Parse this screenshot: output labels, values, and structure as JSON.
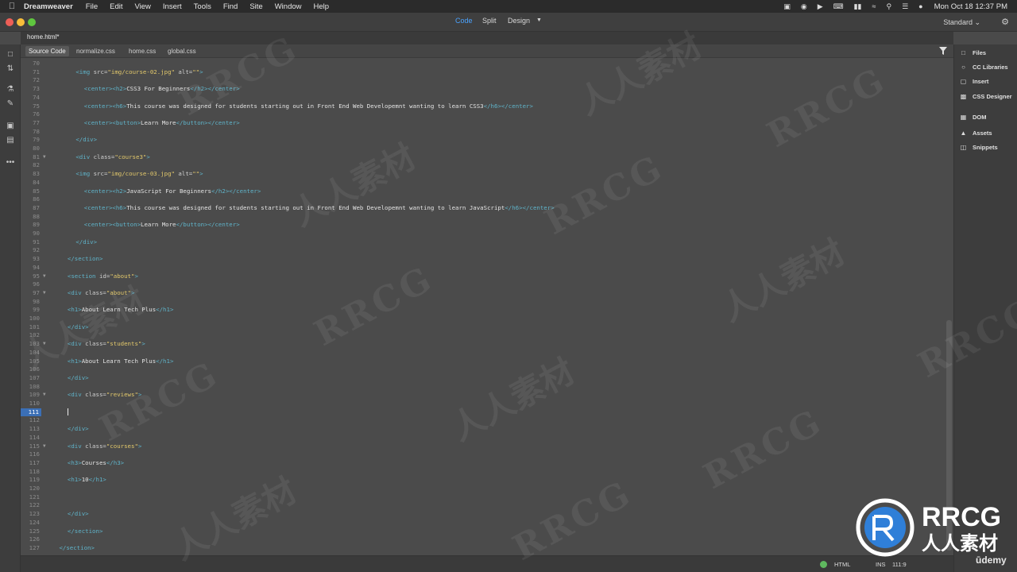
{
  "menubar": {
    "app_name": "Dreamweaver",
    "items": [
      "File",
      "Edit",
      "View",
      "Insert",
      "Tools",
      "Find",
      "Site",
      "Window",
      "Help"
    ],
    "clock": "Mon Oct 18  12:37 PM"
  },
  "toolbar": {
    "views": [
      "Code",
      "Split",
      "Design"
    ],
    "active_view": "Code",
    "workspace": "Standard"
  },
  "document": {
    "tab": "home.html*",
    "related_files": [
      "Source Code",
      "normalize.css",
      "home.css",
      "global.css"
    ],
    "active_related": "Source Code"
  },
  "right_panel": {
    "items": [
      {
        "label": "Files",
        "icon": "files-icon"
      },
      {
        "label": "CC Libraries",
        "icon": "cc-libraries-icon"
      },
      {
        "label": "Insert",
        "icon": "insert-icon"
      },
      {
        "label": "CSS Designer",
        "icon": "css-designer-icon"
      },
      {
        "label": "DOM",
        "icon": "dom-icon"
      },
      {
        "label": "Assets",
        "icon": "assets-icon"
      },
      {
        "label": "Snippets",
        "icon": "snippets-icon"
      }
    ]
  },
  "editor": {
    "current_line": 111,
    "lines": [
      {
        "n": 70,
        "indent": 0,
        "code": ""
      },
      {
        "n": 71,
        "indent": 3,
        "code": "<img src=\"img/course-02.jpg\" alt=\"\">"
      },
      {
        "n": 72,
        "indent": 0,
        "code": ""
      },
      {
        "n": 73,
        "indent": 4,
        "code": "<center><h2>CSS3 For Beginners</h2></center>"
      },
      {
        "n": 74,
        "indent": 0,
        "code": ""
      },
      {
        "n": 75,
        "indent": 4,
        "code": "<center><h6>This course was designed for students starting out in Front End Web Developemnt wanting to learn CSS3</h6></center>"
      },
      {
        "n": 76,
        "indent": 0,
        "code": ""
      },
      {
        "n": 77,
        "indent": 4,
        "code": "<center><button>Learn More</button></center>"
      },
      {
        "n": 78,
        "indent": 0,
        "code": ""
      },
      {
        "n": 79,
        "indent": 3,
        "code": "</div>"
      },
      {
        "n": 80,
        "indent": 0,
        "code": ""
      },
      {
        "n": 81,
        "indent": 3,
        "code": "<div class=\"course3\">",
        "fold": true
      },
      {
        "n": 82,
        "indent": 0,
        "code": ""
      },
      {
        "n": 83,
        "indent": 3,
        "code": "<img src=\"img/course-03.jpg\" alt=\"\">"
      },
      {
        "n": 84,
        "indent": 0,
        "code": ""
      },
      {
        "n": 85,
        "indent": 4,
        "code": "<center><h2>JavaScript For Beginners</h2></center>"
      },
      {
        "n": 86,
        "indent": 0,
        "code": ""
      },
      {
        "n": 87,
        "indent": 4,
        "code": "<center><h6>This course was designed for students starting out in Front End Web Developemnt wanting to learn JavaScript</h6></center>"
      },
      {
        "n": 88,
        "indent": 0,
        "code": ""
      },
      {
        "n": 89,
        "indent": 4,
        "code": "<center><button>Learn More</button></center>"
      },
      {
        "n": 90,
        "indent": 0,
        "code": ""
      },
      {
        "n": 91,
        "indent": 3,
        "code": "</div>"
      },
      {
        "n": 92,
        "indent": 0,
        "code": ""
      },
      {
        "n": 93,
        "indent": 2,
        "code": "</section>"
      },
      {
        "n": 94,
        "indent": 0,
        "code": ""
      },
      {
        "n": 95,
        "indent": 2,
        "code": "<section id=\"about\">",
        "fold": true
      },
      {
        "n": 96,
        "indent": 0,
        "code": ""
      },
      {
        "n": 97,
        "indent": 2,
        "code": "<div class=\"about\">",
        "fold": true
      },
      {
        "n": 98,
        "indent": 0,
        "code": ""
      },
      {
        "n": 99,
        "indent": 2,
        "code": "<h1>About Learn Tech Plus</h1>"
      },
      {
        "n": 100,
        "indent": 0,
        "code": ""
      },
      {
        "n": 101,
        "indent": 2,
        "code": "</div>"
      },
      {
        "n": 102,
        "indent": 0,
        "code": ""
      },
      {
        "n": 103,
        "indent": 2,
        "code": "<div class=\"students\">",
        "fold": true
      },
      {
        "n": 104,
        "indent": 0,
        "code": ""
      },
      {
        "n": 105,
        "indent": 2,
        "code": "<h1>About Learn Tech Plus</h1>"
      },
      {
        "n": 106,
        "indent": 0,
        "code": ""
      },
      {
        "n": 107,
        "indent": 2,
        "code": "</div>"
      },
      {
        "n": 108,
        "indent": 0,
        "code": ""
      },
      {
        "n": 109,
        "indent": 2,
        "code": "<div class=\"reviews\">",
        "fold": true
      },
      {
        "n": 110,
        "indent": 0,
        "code": ""
      },
      {
        "n": 111,
        "indent": 2,
        "code": "",
        "cursor": true
      },
      {
        "n": 112,
        "indent": 0,
        "code": ""
      },
      {
        "n": 113,
        "indent": 2,
        "code": "</div>"
      },
      {
        "n": 114,
        "indent": 0,
        "code": ""
      },
      {
        "n": 115,
        "indent": 2,
        "code": "<div class=\"courses\">",
        "fold": true
      },
      {
        "n": 116,
        "indent": 0,
        "code": ""
      },
      {
        "n": 117,
        "indent": 2,
        "code": "<h3>Courses</h3>"
      },
      {
        "n": 118,
        "indent": 0,
        "code": ""
      },
      {
        "n": 119,
        "indent": 2,
        "code": "<h1>10</h1>"
      },
      {
        "n": 120,
        "indent": 0,
        "code": ""
      },
      {
        "n": 121,
        "indent": 0,
        "code": ""
      },
      {
        "n": 122,
        "indent": 0,
        "code": ""
      },
      {
        "n": 123,
        "indent": 2,
        "code": "</div>"
      },
      {
        "n": 124,
        "indent": 0,
        "code": ""
      },
      {
        "n": 125,
        "indent": 2,
        "code": "</section>"
      },
      {
        "n": 126,
        "indent": 0,
        "code": ""
      },
      {
        "n": 127,
        "indent": 1,
        "code": "</section>"
      }
    ]
  },
  "statusbar": {
    "language": "HTML",
    "mode": "INS",
    "position": "111:9"
  },
  "branding": {
    "watermark_en": "RRCG",
    "watermark_cn": "人人素材",
    "logo_en": "RRCG",
    "logo_cn": "人人素材",
    "course_brand": "ūdemy"
  },
  "colors": {
    "tag": "#5fb3c9",
    "value": "#e2c86b",
    "text": "#e3e3e3",
    "accent": "#4aa3ff"
  }
}
